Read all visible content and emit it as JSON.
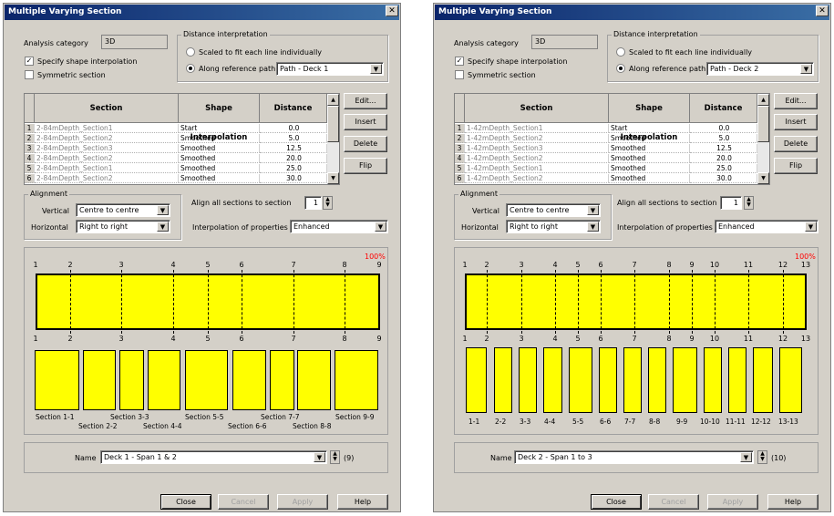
{
  "colors": {
    "section_fill": "#ffff00",
    "percent_label": "#ff0000",
    "titlebar": "#0a246a"
  },
  "dialogs": [
    {
      "title": "Multiple Varying Section",
      "close_glyph": "✕",
      "analysis_label": "Analysis category",
      "analysis_value": "3D",
      "specify_shape_label": "Specify shape interpolation",
      "specify_shape_checked": "✓",
      "symmetric_label": "Symmetric section",
      "distance_group": "Distance interpretation",
      "scaled_label": "Scaled to fit each line individually",
      "along_label": "Along reference path",
      "path_value": "Path - Deck 1",
      "table": {
        "headers": [
          "Section",
          "Shape Interpolation",
          "Distance"
        ],
        "rows": [
          {
            "n": "1",
            "section": "2-84mDepth_Section1",
            "interp": "Start",
            "dist": "0.0"
          },
          {
            "n": "2",
            "section": "2-84mDepth_Section2",
            "interp": "Smoothed",
            "dist": "5.0"
          },
          {
            "n": "3",
            "section": "2-84mDepth_Section3",
            "interp": "Smoothed",
            "dist": "12.5"
          },
          {
            "n": "4",
            "section": "2-84mDepth_Section2",
            "interp": "Smoothed",
            "dist": "20.0"
          },
          {
            "n": "5",
            "section": "2-84mDepth_Section1",
            "interp": "Smoothed",
            "dist": "25.0"
          },
          {
            "n": "6",
            "section": "2-84mDepth_Section2",
            "interp": "Smoothed",
            "dist": "30.0"
          }
        ]
      },
      "buttons": {
        "edit": "Edit...",
        "insert": "Insert",
        "delete": "Delete",
        "flip": "Flip"
      },
      "alignment_group": "Alignment",
      "vertical_label": "Vertical",
      "vertical_value": "Centre to centre",
      "horizontal_label": "Horizontal",
      "horizontal_value": "Right to right",
      "align_all_label": "Align all sections to section",
      "align_all_value": "1",
      "interp_props_label": "Interpolation of properties",
      "interp_props_value": "Enhanced",
      "percent": "100%",
      "top_marks": [
        "1",
        "2",
        "3",
        "4",
        "5",
        "6",
        "7",
        "8",
        "9"
      ],
      "bottom_marks": [
        "1",
        "2",
        "3",
        "4",
        "5",
        "6",
        "7",
        "8",
        "9"
      ],
      "section_labels_upper": [
        "Section 1-1",
        "Section 3-3",
        "Section 5-5",
        "Section 7-7",
        "Section 9-9"
      ],
      "section_labels_lower": [
        "Section 2-2",
        "Section 4-4",
        "Section 6-6",
        "Section 8-8"
      ],
      "name_label": "Name",
      "name_value": "Deck 1 - Span 1 & 2",
      "name_count": "(9)",
      "footer": {
        "close": "Close",
        "cancel": "Cancel",
        "apply": "Apply",
        "help": "Help"
      }
    },
    {
      "title": "Multiple Varying Section",
      "close_glyph": "✕",
      "analysis_label": "Analysis category",
      "analysis_value": "3D",
      "specify_shape_label": "Specify shape interpolation",
      "specify_shape_checked": "✓",
      "symmetric_label": "Symmetric section",
      "distance_group": "Distance interpretation",
      "scaled_label": "Scaled to fit each line individually",
      "along_label": "Along reference path",
      "path_value": "Path - Deck 2",
      "table": {
        "headers": [
          "Section",
          "Shape Interpolation",
          "Distance"
        ],
        "rows": [
          {
            "n": "1",
            "section": "1-42mDepth_Section1",
            "interp": "Start",
            "dist": "0.0"
          },
          {
            "n": "2",
            "section": "1-42mDepth_Section2",
            "interp": "Smoothed",
            "dist": "5.0"
          },
          {
            "n": "3",
            "section": "1-42mDepth_Section3",
            "interp": "Smoothed",
            "dist": "12.5"
          },
          {
            "n": "4",
            "section": "1-42mDepth_Section2",
            "interp": "Smoothed",
            "dist": "20.0"
          },
          {
            "n": "5",
            "section": "1-42mDepth_Section1",
            "interp": "Smoothed",
            "dist": "25.0"
          },
          {
            "n": "6",
            "section": "1-42mDepth_Section2",
            "interp": "Smoothed",
            "dist": "30.0"
          }
        ]
      },
      "buttons": {
        "edit": "Edit...",
        "insert": "Insert",
        "delete": "Delete",
        "flip": "Flip"
      },
      "alignment_group": "Alignment",
      "vertical_label": "Vertical",
      "vertical_value": "Centre to centre",
      "horizontal_label": "Horizontal",
      "horizontal_value": "Right to right",
      "align_all_label": "Align all sections to section",
      "align_all_value": "1",
      "interp_props_label": "Interpolation of properties",
      "interp_props_value": "Enhanced",
      "percent": "100%",
      "top_marks": [
        "1",
        "2",
        "3",
        "4",
        "5",
        "6",
        "7",
        "8",
        "9",
        "10",
        "11",
        "12",
        "13"
      ],
      "bottom_marks": [
        "1",
        "2",
        "3",
        "4",
        "5",
        "6",
        "7",
        "8",
        "9",
        "10",
        "11",
        "12",
        "13"
      ],
      "section_labels": [
        "1-1",
        "2-2",
        "3-3",
        "4-4",
        "5-5",
        "6-6",
        "7-7",
        "8-8",
        "9-9",
        "10-10",
        "11-11",
        "12-12",
        "13-13"
      ],
      "name_label": "Name",
      "name_value": "Deck 2 - Span 1 to 3",
      "name_count": "(10)",
      "footer": {
        "close": "Close",
        "cancel": "Cancel",
        "apply": "Apply",
        "help": "Help"
      }
    }
  ]
}
